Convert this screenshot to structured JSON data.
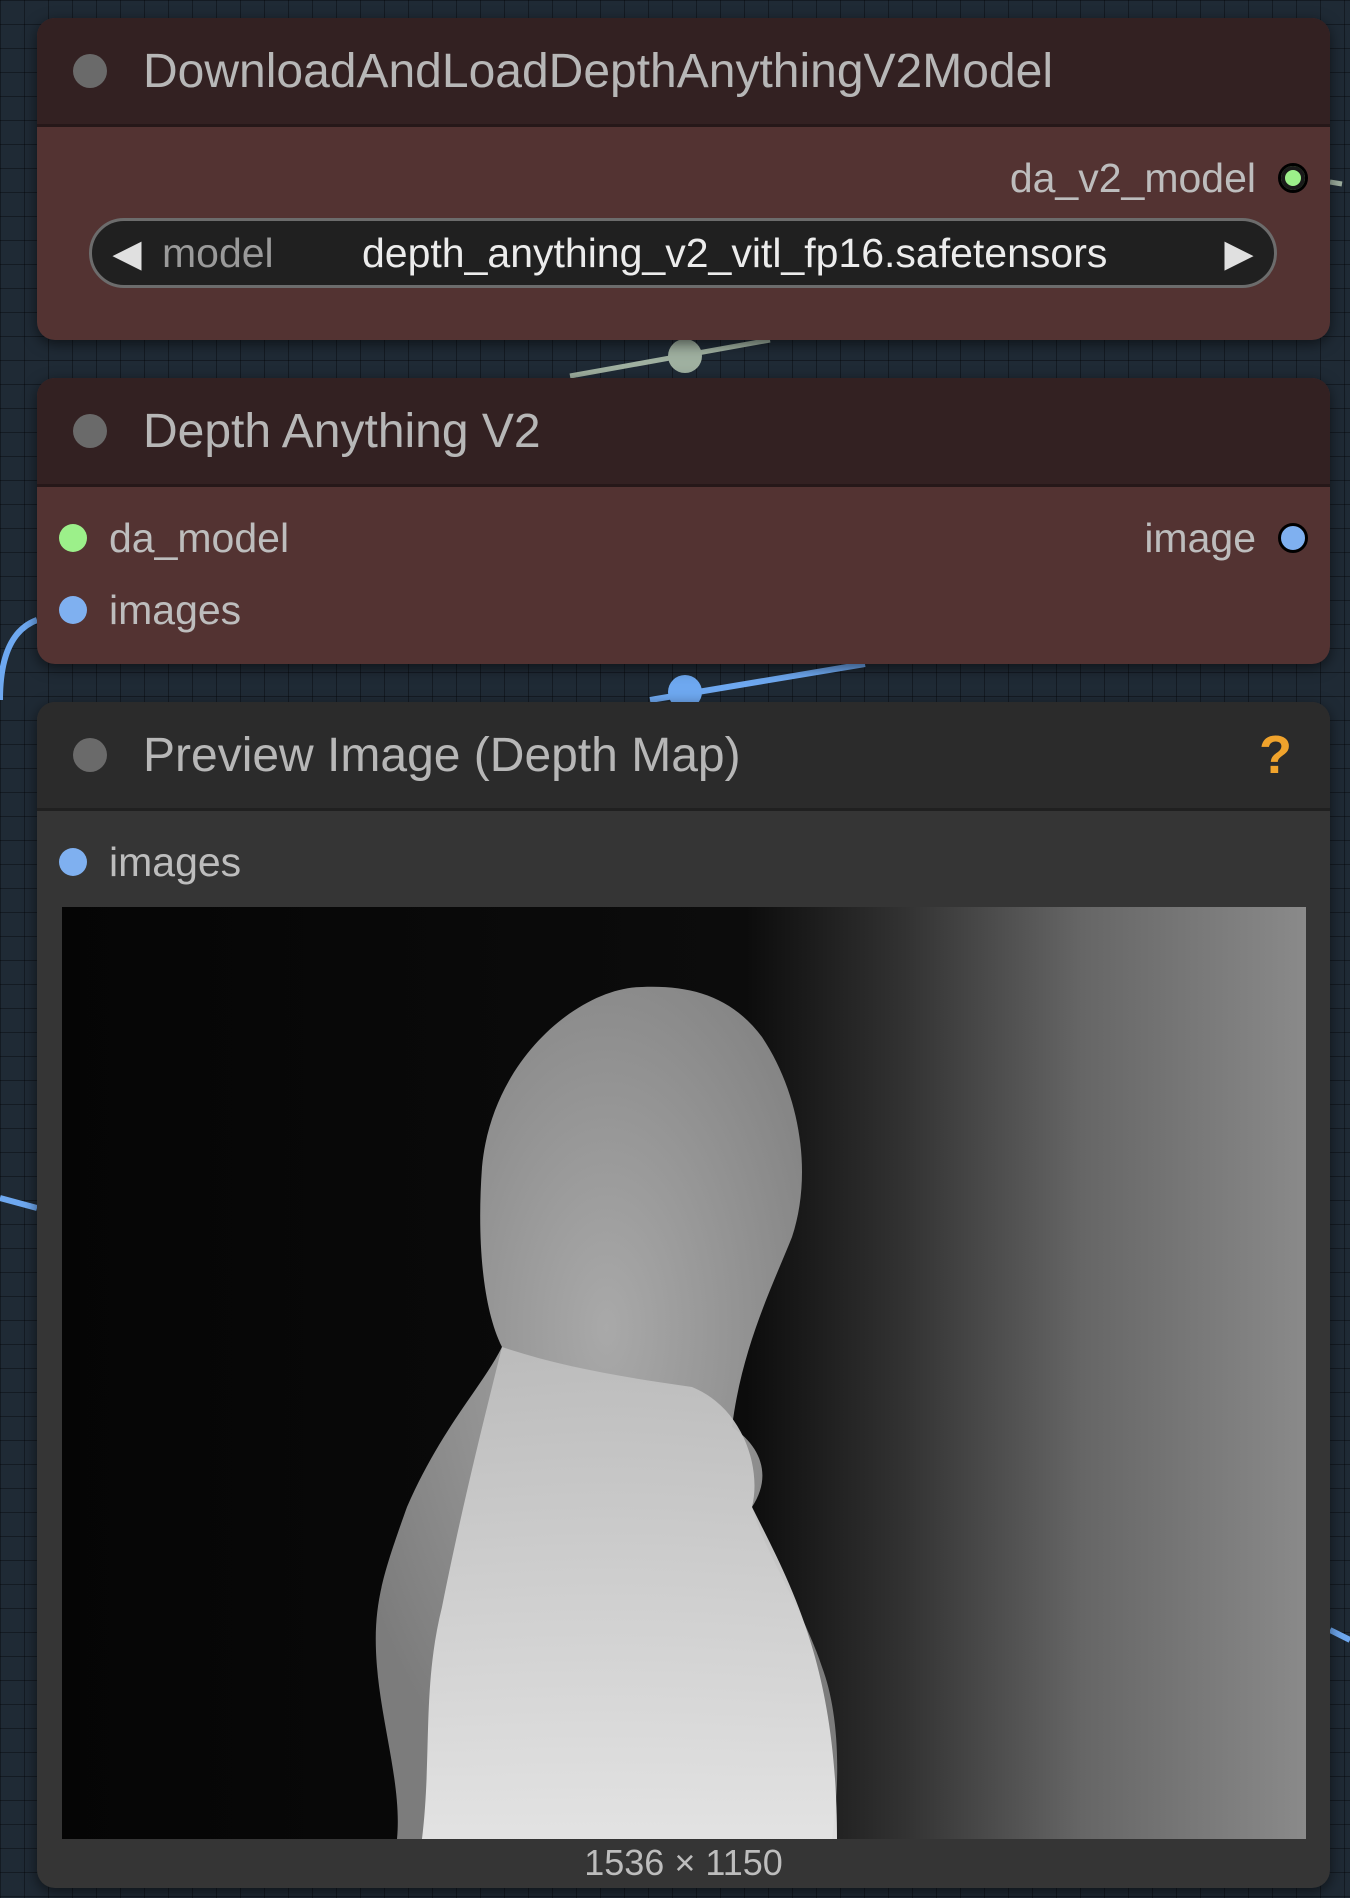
{
  "node_loader": {
    "title": "DownloadAndLoadDepthAnythingV2Model",
    "output_label": "da_v2_model",
    "widget_label": "model",
    "widget_value": "depth_anything_v2_vitl_fp16.safetensors",
    "arrow_left": "◀",
    "arrow_right": "▶"
  },
  "node_depth": {
    "title": "Depth Anything V2",
    "inputs": [
      "da_model",
      "images"
    ],
    "output_label": "image"
  },
  "node_preview": {
    "title": "Preview Image (Depth Map)",
    "help": "?",
    "input_label": "images",
    "image_dims": "1536 × 1150"
  },
  "colors": {
    "model_slot": "#9cf08a",
    "image_slot": "#7fb0f0",
    "help": "#f0a32c"
  }
}
